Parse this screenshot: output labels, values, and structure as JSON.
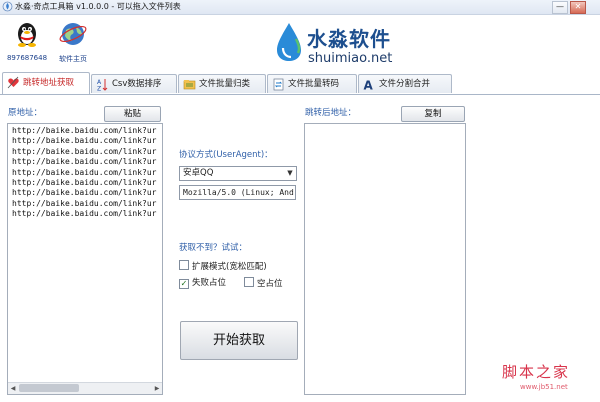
{
  "window": {
    "title": "水淼·奇点工具箱 v1.0.0.0 - 可以拖入文件列表",
    "minimize_symbol": "—",
    "close_symbol": "✕"
  },
  "header": {
    "shortcuts": [
      {
        "label": "897687648",
        "icon": "qq-penguin-icon"
      },
      {
        "label": "软件主页",
        "icon": "globe-icon"
      }
    ],
    "brand_cn": "水淼软件",
    "brand_en": "shuimiao.net",
    "logo_icon": "water-drop-icon"
  },
  "tabs": [
    {
      "label": "跳转地址获取",
      "icon": "heart-arrow-icon",
      "active": true
    },
    {
      "label": "Csv数据排序",
      "icon": "sort-az-icon",
      "active": false
    },
    {
      "label": "文件批量归类",
      "icon": "folder-sort-icon",
      "active": false
    },
    {
      "label": "文件批量转码",
      "icon": "file-convert-icon",
      "active": false
    },
    {
      "label": "文件分割合并",
      "icon": "split-merge-icon",
      "active": false
    }
  ],
  "source": {
    "label": "原地址：",
    "paste_button": "粘贴",
    "urls": [
      "http://baike.baidu.com/link?ur",
      "http://baike.baidu.com/link?ur",
      "http://baike.baidu.com/link?ur",
      "http://baike.baidu.com/link?ur",
      "http://baike.baidu.com/link?ur",
      "http://baike.baidu.com/link?ur",
      "http://baike.baidu.com/link?ur",
      "http://baike.baidu.com/link?ur",
      "http://baike.baidu.com/link?ur"
    ]
  },
  "options": {
    "protocol_label": "协议方式(UserAgent)：",
    "protocol_selected": "安卓QQ",
    "useragent_value": "Mozilla/5.0 (Linux; And",
    "retry_label": "获取不到？试试：",
    "extended_mode": {
      "label": "扩展模式(宽松匹配)",
      "checked": false
    },
    "fail_placeholder": {
      "label": "失败占位",
      "checked": true
    },
    "empty_placeholder": {
      "label": "空占位",
      "checked": false
    },
    "start_button": "开始获取"
  },
  "result": {
    "label": "跳转后地址：",
    "copy_button": "复制"
  },
  "watermark": {
    "cn": "脚本之家",
    "url": "www.jb51.net"
  }
}
